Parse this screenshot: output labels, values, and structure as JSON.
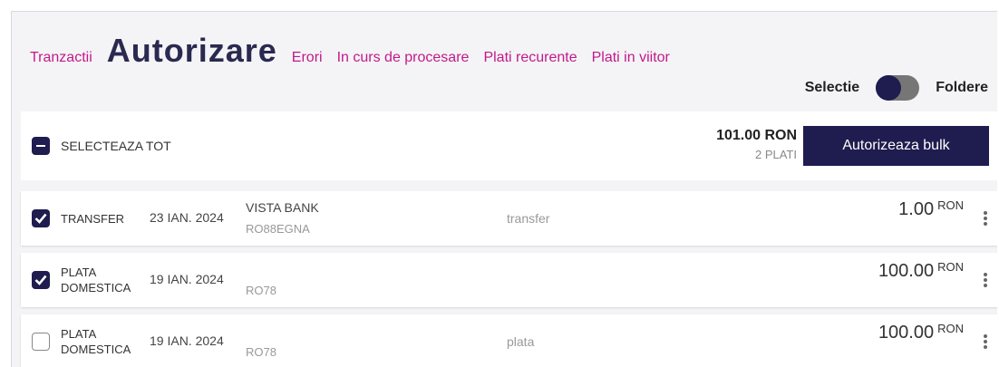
{
  "tabs": [
    {
      "label": "Tranzactii",
      "active": false
    },
    {
      "label": "Autorizare",
      "active": true
    },
    {
      "label": "Erori",
      "active": false
    },
    {
      "label": "In curs de procesare",
      "active": false
    },
    {
      "label": "Plati recurente",
      "active": false
    },
    {
      "label": "Plati in viitor",
      "active": false
    }
  ],
  "view_toggle": {
    "left_label": "Selectie",
    "right_label": "Foldere"
  },
  "bulk": {
    "select_all_label": "SELECTEAZA TOT",
    "total_amount": "101.00 RON",
    "total_count": "2 PLATI",
    "authorize_label": "Autorizeaza bulk"
  },
  "rows": [
    {
      "checked": true,
      "type_line1": "TRANSFER",
      "type_line2": "",
      "date": "23 IAN. 2024",
      "beneficiary": "VISTA BANK",
      "iban": "RO88EGNA",
      "description": "transfer",
      "amount": "1.00",
      "currency": "RON"
    },
    {
      "checked": true,
      "type_line1": "PLATA",
      "type_line2": "DOMESTICA",
      "date": "19 IAN. 2024",
      "beneficiary": "",
      "iban": "RO78",
      "description": "",
      "amount": "100.00",
      "currency": "RON"
    },
    {
      "checked": false,
      "type_line1": "PLATA",
      "type_line2": "DOMESTICA",
      "date": "19 IAN. 2024",
      "beneficiary": "",
      "iban": "RO78",
      "description": "plata",
      "amount": "100.00",
      "currency": "RON"
    }
  ]
}
